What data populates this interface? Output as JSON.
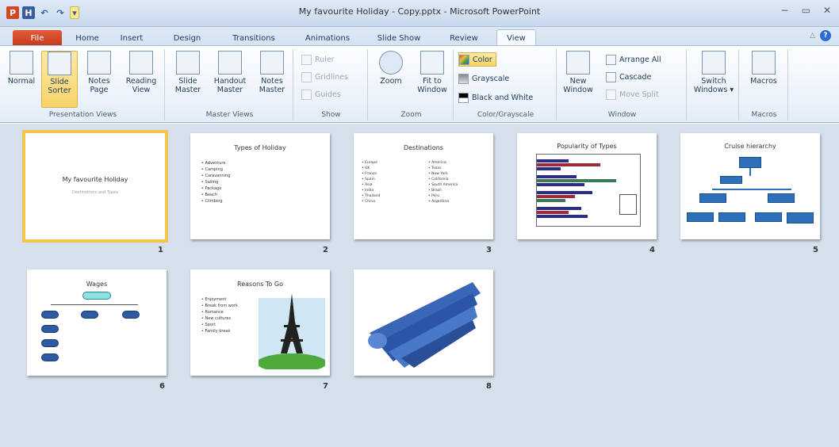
{
  "window": {
    "title": "My favourite Holiday - Copy.pptx - Microsoft PowerPoint",
    "minimize": "−",
    "restore": "▭",
    "close": "✕"
  },
  "qat": {
    "app": "P",
    "save": "H",
    "undo": "↶",
    "redo": "↷",
    "drop": "▾"
  },
  "tabs": [
    "File",
    "Home",
    "Insert",
    "Design",
    "Transitions",
    "Animations",
    "Slide Show",
    "Review",
    "View"
  ],
  "active_tab": "View",
  "help": {
    "min": "△",
    "q": "?"
  },
  "ribbon": {
    "presentation_views": {
      "label": "Presentation Views",
      "normal": "Normal",
      "slide_sorter": "Slide Sorter",
      "notes_page": "Notes Page",
      "reading_view": "Reading View"
    },
    "master_views": {
      "label": "Master Views",
      "slide_master": "Slide Master",
      "handout_master": "Handout Master",
      "notes_master": "Notes Master"
    },
    "show": {
      "label": "Show",
      "ruler": "Ruler",
      "gridlines": "Gridlines",
      "guides": "Guides"
    },
    "zoom": {
      "label": "Zoom",
      "zoom": "Zoom",
      "fit": "Fit to Window"
    },
    "color": {
      "label": "Color/Grayscale",
      "color": "Color",
      "grayscale": "Grayscale",
      "bw": "Black and White"
    },
    "window": {
      "label": "Window",
      "new_window": "New Window",
      "arrange_all": "Arrange All",
      "cascade": "Cascade",
      "move_split": "Move Split",
      "switch": "Switch Windows ▾"
    },
    "macros": {
      "label": "Macros",
      "macros": "Macros"
    }
  },
  "slides": [
    {
      "num": "1",
      "title": "My favourite Holiday",
      "subtitle": "Destinations and Types"
    },
    {
      "num": "2",
      "title": "Types of Holiday",
      "bullets": [
        "Adventure",
        "Camping",
        "Caravanning",
        "Sailing",
        "Package",
        "Beach",
        "Climbing"
      ]
    },
    {
      "num": "3",
      "title": "Destinations",
      "left": [
        "Europe",
        "UK",
        "France",
        "Spain",
        "Asia",
        "India",
        "Thailand",
        "China"
      ],
      "right": [
        "America",
        "Texas",
        "New York",
        "California",
        "South America",
        "Brazil",
        "Peru",
        "Argentina"
      ]
    },
    {
      "num": "4",
      "title": "Popularity of Types"
    },
    {
      "num": "5",
      "title": "Cruise hierarchy"
    },
    {
      "num": "6",
      "title": "Wages"
    },
    {
      "num": "7",
      "title": "Reasons To Go",
      "bullets": [
        "Enjoyment",
        "Break from work",
        "Romance",
        "New cultures",
        "Sport",
        "Family break"
      ]
    },
    {
      "num": "8"
    }
  ],
  "colors": {
    "accent": "#f2c64d",
    "file_tab": "#d24726",
    "sorter_bg": "#d5e0ec",
    "org_blue": "#2d6fb8"
  }
}
